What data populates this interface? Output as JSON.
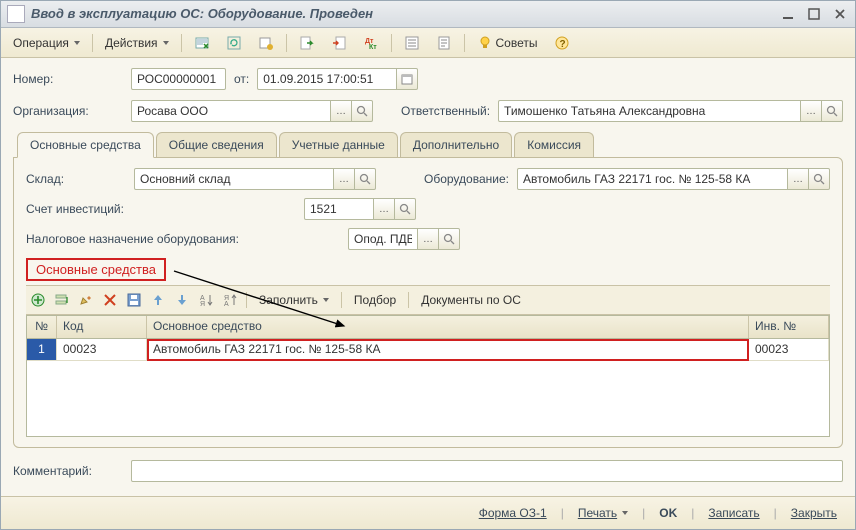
{
  "window": {
    "title": "Ввод в эксплуатацию ОС: Оборудование. Проведен"
  },
  "toolbar": {
    "operation": "Операция",
    "actions": "Действия",
    "tips": "Советы"
  },
  "form": {
    "number_label": "Номер:",
    "number_value": "РОС00000001",
    "date_label": "от:",
    "date_value": "01.09.2015 17:00:51",
    "org_label": "Организация:",
    "org_value": "Росава ООО",
    "responsible_label": "Ответственный:",
    "responsible_value": "Тимошенко Татьяна Александровна"
  },
  "tabs": {
    "main": "Основные средства",
    "general": "Общие сведения",
    "accounting": "Учетные данные",
    "additional": "Дополнительно",
    "commission": "Комиссия"
  },
  "panel": {
    "warehouse_label": "Склад:",
    "warehouse_value": "Основний склад",
    "equipment_label": "Оборудование:",
    "equipment_value": "Автомобиль ГАЗ 22171 гос. № 125-58 КА",
    "inv_account_label": "Счет инвестиций:",
    "inv_account_value": "1521",
    "tax_label": "Налоговое назначение оборудования:",
    "tax_value": "Опод. ПДВ",
    "section_title": "Основные средства"
  },
  "grid_toolbar": {
    "fill": "Заполнить",
    "pick": "Подбор",
    "docs_os": "Документы по ОС"
  },
  "grid": {
    "headers": {
      "idx": "№",
      "code": "Код",
      "main": "Основное средство",
      "inv": "Инв. №"
    },
    "row": {
      "idx": "1",
      "code": "00023",
      "main": "Автомобиль ГАЗ 22171 гос. № 125-58 КА",
      "inv": "00023"
    }
  },
  "comment_label": "Комментарий:",
  "status": {
    "form_os1": "Форма ОЗ-1",
    "print": "Печать",
    "ok": "OK",
    "save": "Записать",
    "close": "Закрыть"
  }
}
